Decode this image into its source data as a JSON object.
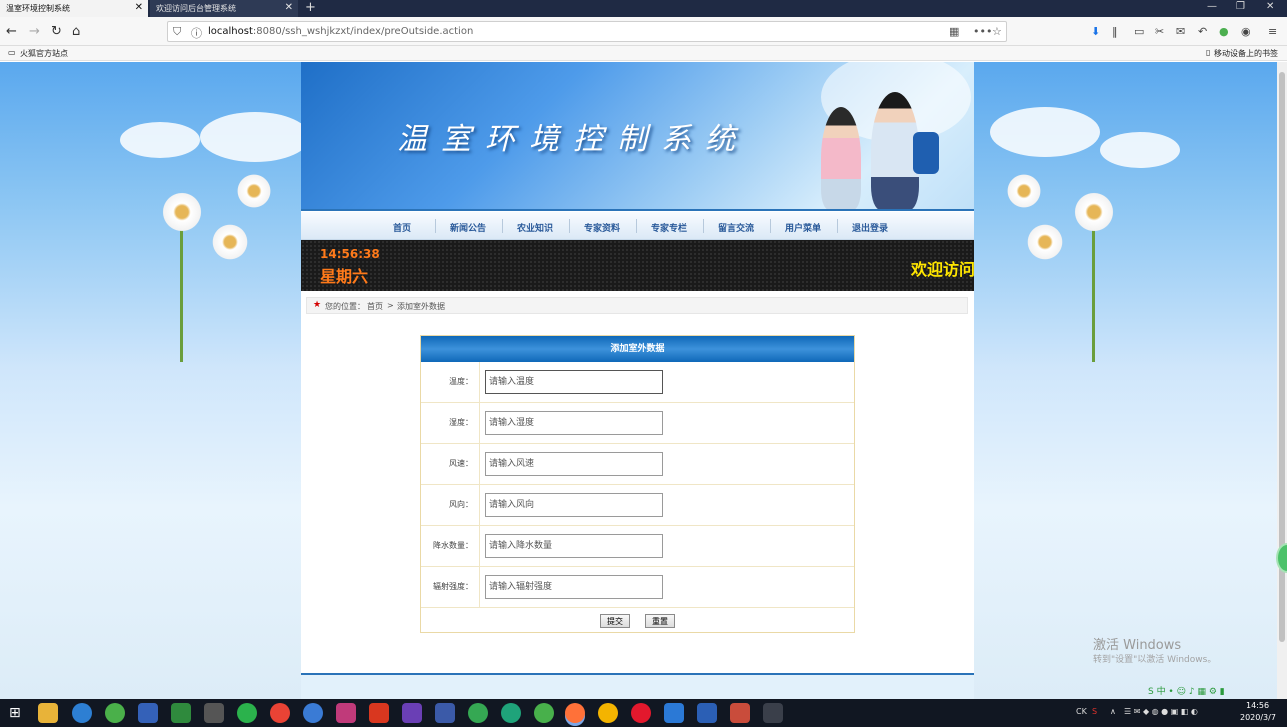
{
  "browser": {
    "tabs": [
      {
        "label": "温室环境控制系统",
        "active": true
      },
      {
        "label": "欢迎访问后台管理系统",
        "active": false
      }
    ],
    "url_host": "localhost",
    "url_rest": ":8080/ssh_wshjkzxt/index/preOutside.action",
    "bookmark_left": "火狐官方站点",
    "bookmark_right": "移动设备上的书签"
  },
  "banner": {
    "title": "温室环境控制系统"
  },
  "menu": [
    "首页",
    "新闻公告",
    "农业知识",
    "专家资料",
    "专家专栏",
    "留言交流",
    "用户菜单",
    "退出登录"
  ],
  "led": {
    "time": "14:56:38",
    "day": "星期六",
    "welcome": "欢迎访问"
  },
  "breadcrumb": {
    "prefix": "您的位置：",
    "home": "首页",
    "separator": ">",
    "current": "添加室外数据"
  },
  "form": {
    "title": "添加室外数据",
    "fields": [
      {
        "label": "温度：",
        "placeholder": "请输入温度"
      },
      {
        "label": "湿度：",
        "placeholder": "请输入湿度"
      },
      {
        "label": "风速：",
        "placeholder": "请输入风速"
      },
      {
        "label": "风向：",
        "placeholder": "请输入风向"
      },
      {
        "label": "降水数量：",
        "placeholder": "请输入降水数量"
      },
      {
        "label": "辐射强度：",
        "placeholder": "请输入辐射强度"
      }
    ],
    "submit": "提交",
    "reset": "重置"
  },
  "watermark": {
    "line1": "激活 Windows",
    "line2": "转到\"设置\"以激活 Windows。"
  },
  "taskbar": {
    "time": "14:56",
    "date": "2020/3/7",
    "lang": "CK"
  },
  "colors": {
    "banner_blue": "#1f6fc7",
    "menu_text": "#2a5a9a",
    "led_orange": "#ff7a1a",
    "led_yellow": "#ffe600",
    "form_header": "#0f68b8"
  }
}
